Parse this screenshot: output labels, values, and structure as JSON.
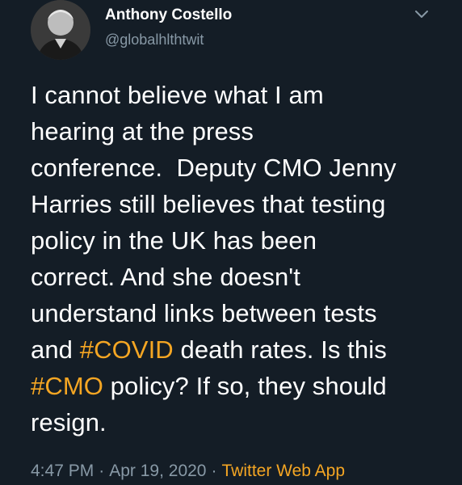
{
  "author": {
    "name": "Anthony Costello",
    "handle": "@globalhlthtwit",
    "avatar_icon": "profile-photo"
  },
  "menu_icon": "chevron-down-icon",
  "tweet": {
    "lines": [
      [
        "I cannot believe what I am"
      ],
      [
        "hearing at the press"
      ],
      [
        "conference.  Deputy CMO Jenny"
      ],
      [
        "Harries still believes that testing"
      ],
      [
        "policy in the UK has been"
      ],
      [
        "correct. And she doesn't"
      ],
      [
        "understand links between tests"
      ],
      [
        "and ",
        "#COVID",
        " death rates. Is this"
      ],
      [
        "#CMO",
        " policy? If so, they should"
      ],
      [
        "resign."
      ]
    ]
  },
  "meta": {
    "time": "4:47 PM",
    "date": "Apr 19, 2020",
    "separator": "·",
    "source": "Twitter Web App"
  },
  "colors": {
    "background": "#141d26",
    "hashtag": "#f5a623",
    "secondary_text": "#8899a6"
  }
}
